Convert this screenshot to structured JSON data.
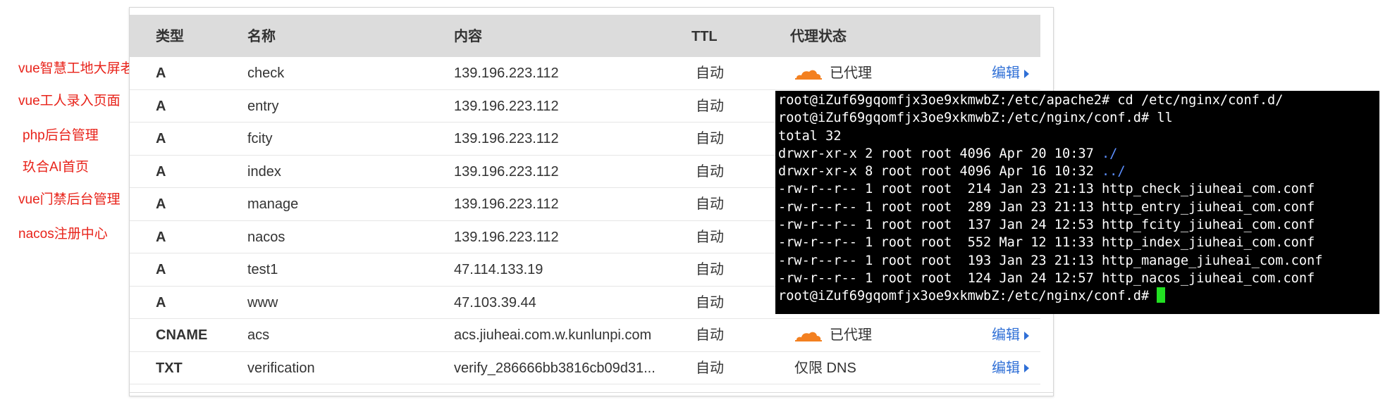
{
  "annotations": [
    "vue智慧工地大屏老版",
    "vue工人录入页面",
    "php后台管理",
    "玖合AI首页",
    "vue门禁后台管理",
    "nacos注册中心"
  ],
  "table": {
    "headers": {
      "type": "类型",
      "name": "名称",
      "content": "内容",
      "ttl": "TTL",
      "proxy": "代理状态"
    },
    "rows": [
      {
        "type": "A",
        "name": "check",
        "content": "139.196.223.112",
        "ttl": "自动",
        "proxy": "已代理",
        "edit": "编辑"
      },
      {
        "type": "A",
        "name": "entry",
        "content": "139.196.223.112",
        "ttl": "自动",
        "proxy": "",
        "edit": ""
      },
      {
        "type": "A",
        "name": "fcity",
        "content": "139.196.223.112",
        "ttl": "自动",
        "proxy": "",
        "edit": ""
      },
      {
        "type": "A",
        "name": "index",
        "content": "139.196.223.112",
        "ttl": "自动",
        "proxy": "",
        "edit": ""
      },
      {
        "type": "A",
        "name": "manage",
        "content": "139.196.223.112",
        "ttl": "自动",
        "proxy": "",
        "edit": ""
      },
      {
        "type": "A",
        "name": "nacos",
        "content": "139.196.223.112",
        "ttl": "自动",
        "proxy": "",
        "edit": ""
      },
      {
        "type": "A",
        "name": "test1",
        "content": "47.114.133.19",
        "ttl": "自动",
        "proxy": "",
        "edit": ""
      },
      {
        "type": "A",
        "name": "www",
        "content": "47.103.39.44",
        "ttl": "自动",
        "proxy": "",
        "edit": ""
      },
      {
        "type": "CNAME",
        "name": "acs",
        "content": "acs.jiuheai.com.w.kunlunpi.com",
        "ttl": "自动",
        "proxy": "已代理",
        "edit": "编辑"
      },
      {
        "type": "TXT",
        "name": "verification",
        "content": "verify_286666bb3816cb09d31...",
        "ttl": "自动",
        "proxy": "仅限 DNS",
        "edit": "编辑"
      }
    ]
  },
  "colors": {
    "annotation": "#e8231a",
    "link": "#2f6fd6",
    "cloud": "#f38020",
    "terminal_bg": "#000000",
    "terminal_dir": "#5c8fff",
    "terminal_cursor": "#22e022"
  },
  "terminal": {
    "lines": [
      {
        "text": "root@iZuf69gqomfjx3oe9xkmwbZ:/etc/apache2# cd /etc/nginx/conf.d/"
      },
      {
        "text": "root@iZuf69gqomfjx3oe9xkmwbZ:/etc/nginx/conf.d# ll"
      },
      {
        "text": "total 32"
      },
      {
        "text": "drwxr-xr-x 2 root root 4096 Apr 20 10:37 ",
        "dir": "./"
      },
      {
        "text": "drwxr-xr-x 8 root root 4096 Apr 16 10:32 ",
        "dir": "../"
      },
      {
        "text": "-rw-r--r-- 1 root root  214 Jan 23 21:13 http_check_jiuheai_com.conf"
      },
      {
        "text": "-rw-r--r-- 1 root root  289 Jan 23 21:13 http_entry_jiuheai_com.conf"
      },
      {
        "text": "-rw-r--r-- 1 root root  137 Jan 24 12:53 http_fcity_jiuheai_com.conf"
      },
      {
        "text": "-rw-r--r-- 1 root root  552 Mar 12 11:33 http_index_jiuheai_com.conf"
      },
      {
        "text": "-rw-r--r-- 1 root root  193 Jan 23 21:13 http_manage_jiuheai_com.conf"
      },
      {
        "text": "-rw-r--r-- 1 root root  124 Jan 24 12:57 http_nacos_jiuheai_com.conf"
      }
    ],
    "prompt": "root@iZuf69gqomfjx3oe9xkmwbZ:/etc/nginx/conf.d# "
  }
}
